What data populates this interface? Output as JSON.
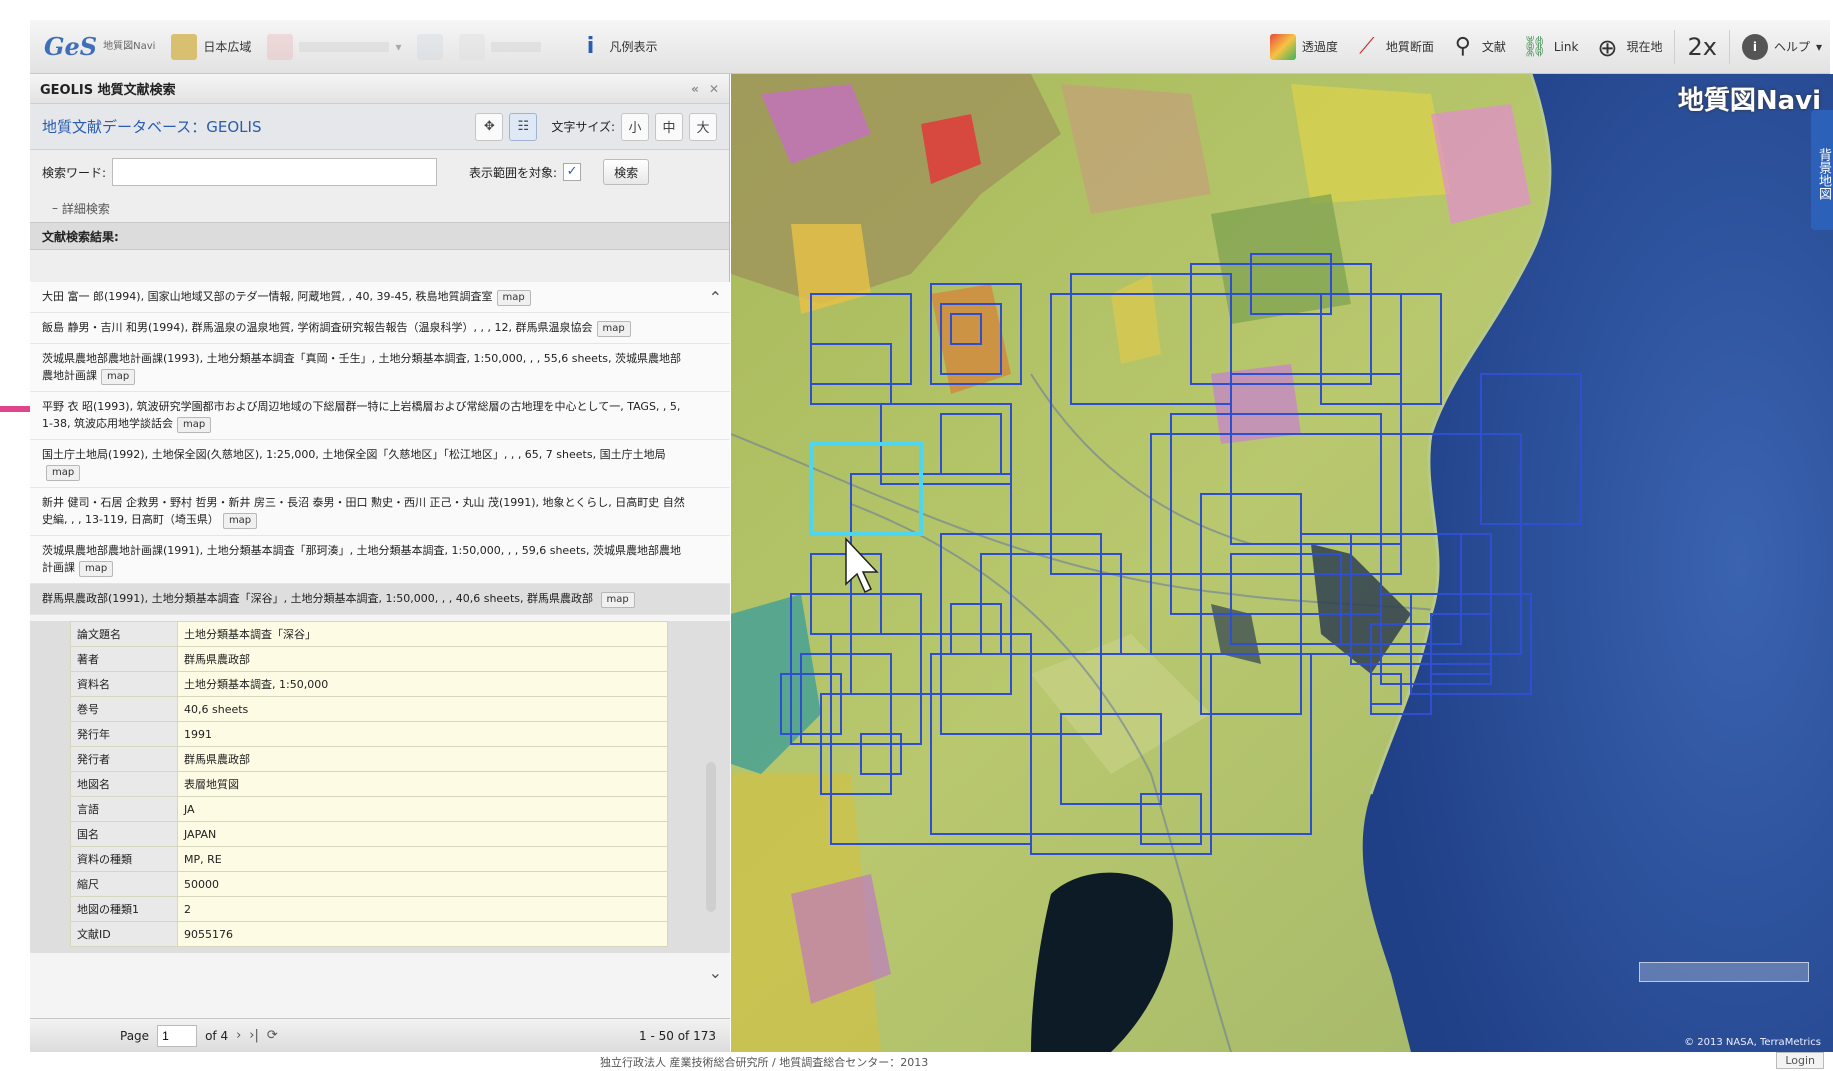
{
  "toolbar": {
    "logo": "GeS",
    "logo_sub": "地質図Navi",
    "region_label": "日本広域",
    "legend_label": "凡例表示",
    "transparency_label": "透過度",
    "cross_section_label": "地質断面",
    "literature_label": "文献",
    "link_label": "Link",
    "current_location_label": "現在地",
    "zoom_label": "2x",
    "help_label": "ヘルプ"
  },
  "panel": {
    "title": "GEOLIS 地質文献検索",
    "db_title": "地質文献データベース：GEOLIS",
    "font_size_label": "文字サイズ:",
    "font_sizes": [
      "小",
      "中",
      "大"
    ],
    "search_label": "検索ワード:",
    "search_value": "",
    "display_range_label": "表示範囲を対象:",
    "display_range_checked": "✓",
    "search_button": "検索",
    "advanced_label": "詳細検索",
    "results_label": "文献検索結果:",
    "results": [
      {
        "text": "大田 富一 郎(1994), 国家山地域又部のテダ一情報, 阿蔵地質, , 40, 39-45, 秩島地質調査室",
        "map": "map"
      },
      {
        "text": "飯島 静男・吉川 和男(1994), 群馬温泉の温泉地質, 学術調査研究報告報告（温泉科学）, , , 12, 群馬県温泉協会",
        "map": "map"
      },
      {
        "text": "茨城県農地部農地計画課(1993), 土地分類基本調査「真岡・壬生」, 土地分類基本調査, 1:50,000, , , 55,6 sheets, 茨城県農地部農地計画課",
        "map": "map"
      },
      {
        "text": "平野 衣 昭(1993), 筑波研究学園都市および周辺地域の下総層群一特に上岩橋層および常総層の古地理を中心として一, TAGS, , 5, 1-38, 筑波応用地学談話会",
        "map": "map"
      },
      {
        "text": "国土庁土地局(1992), 土地保全図(久慈地区), 1:25,000, 土地保全図「久慈地区」「松江地区」, , , 65, 7 sheets, 国土庁土地局",
        "map": "map"
      },
      {
        "text": "新井 健司・石居 企救男・野村 哲男・新井 房三・長沼 泰男・田口 勲史・西川 正己・丸山 茂(1991), 地象とくらし, 日高町史 自然史編, , , 13-119, 日高町（埼玉県）",
        "map": "map"
      },
      {
        "text": "茨城県農地部農地計画課(1991), 土地分類基本調査「那珂湊」, 土地分類基本調査, 1:50,000, , , 59,6 sheets, 茨城県農地部農地計画課",
        "map": "map"
      }
    ],
    "selected_result": {
      "text": "群馬県農政部(1991), 土地分類基本調査「深谷」, 土地分類基本調査, 1:50,000, , , 40,6 sheets, 群馬県農政部",
      "map": "map"
    },
    "details": [
      {
        "key": "論文題名",
        "value": "土地分類基本調査「深谷」"
      },
      {
        "key": "著者",
        "value": "群馬県農政部"
      },
      {
        "key": "資料名",
        "value": "土地分類基本調査, 1:50,000"
      },
      {
        "key": "巻号",
        "value": "40,6 sheets"
      },
      {
        "key": "発行年",
        "value": "1991"
      },
      {
        "key": "発行者",
        "value": "群馬県農政部"
      },
      {
        "key": "地図名",
        "value": "表層地質図"
      },
      {
        "key": "言語",
        "value": "JA"
      },
      {
        "key": "国名",
        "value": "JAPAN"
      },
      {
        "key": "資料の種類",
        "value": "MP, RE"
      },
      {
        "key": "縮尺",
        "value": "50000"
      },
      {
        "key": "地図の種類1",
        "value": "2"
      },
      {
        "key": "文献ID",
        "value": "9055176"
      }
    ],
    "pager": {
      "page_label": "Page",
      "page_value": "1",
      "of_label": "of 4",
      "range": "1 - 50 of 173"
    }
  },
  "map": {
    "brand": "地質図Navi",
    "side_tab": "背景地図",
    "credit": "© 2013 NASA, TerraMetrics"
  },
  "footer": {
    "org": "独立行政法人 産業技術総合研究所 / 地質調査総合センター：2013",
    "login": "Login"
  },
  "colors": {
    "accent": "#2a5db0",
    "bbox": "#2f4fd0",
    "bbox_highlight": "#4fd6ef",
    "sea": "#2e4f99"
  }
}
